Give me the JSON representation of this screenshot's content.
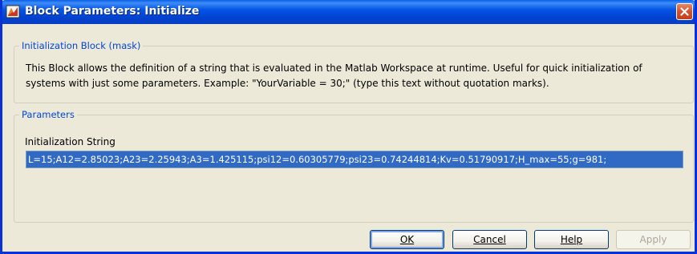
{
  "window": {
    "title": "Block Parameters: Initialize",
    "icon": "matlab-block-icon",
    "close_icon": "close-icon"
  },
  "mask_group": {
    "legend": "Initialization Block (mask)",
    "description": "This Block allows the definition of a string that is evaluated in the Matlab Workspace at runtime. Useful for quick initialization of systems with just some parameters. Example: \"YourVariable = 30;\" (type this text without quotation marks)."
  },
  "parameters_group": {
    "legend": "Parameters",
    "field_label": "Initialization String",
    "field_value": "L=15;A12=2.85023;A23=2.25943;A3=1.425115;psi12=0.60305779;psi23=0.74244814;Kv=0.51790917;H_max=55;g=981;"
  },
  "buttons": {
    "ok": "OK",
    "cancel": "Cancel",
    "help": "Help",
    "apply": "Apply"
  },
  "colors": {
    "titlebar": "#0055e5",
    "legend_text": "#0046d5",
    "selection": "#316ac5",
    "close_button": "#d3512c"
  }
}
